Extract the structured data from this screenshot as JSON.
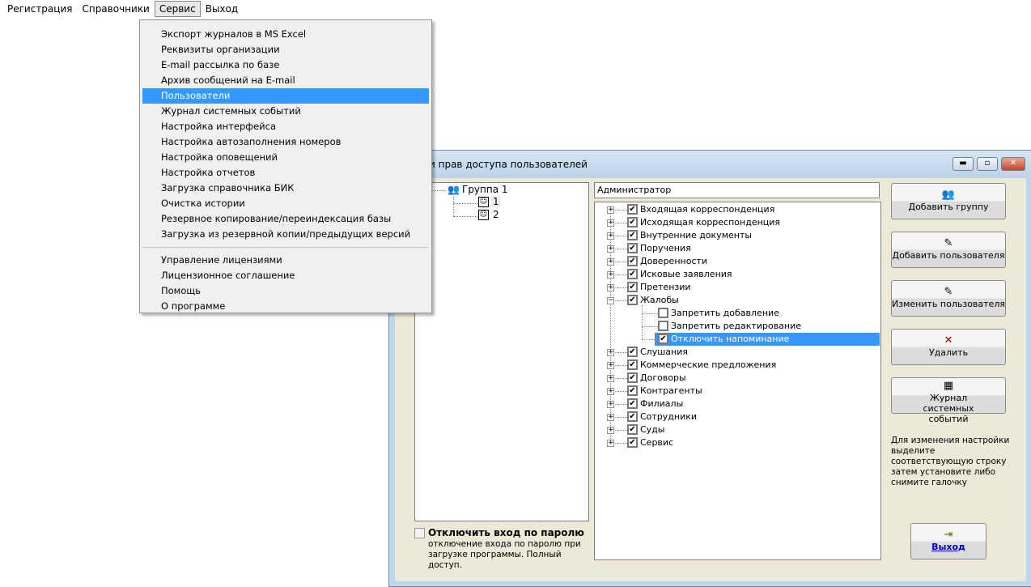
{
  "menubar": [
    "Регистрация",
    "Справочники",
    "Сервис",
    "Выход"
  ],
  "dropdown": {
    "group1": [
      "Экспорт журналов в MS Excel",
      "Реквизиты организации",
      "E-mail рассылка по базе",
      "Архив сообщений на E-mail",
      "Пользователи",
      "Журнал системных событий",
      "Настройка интерфейса",
      "Настройка автозаполнения номеров",
      "Настройка оповещений",
      "Настройка отчетов",
      "Загрузка справочника БИК",
      "Очистка истории",
      "Резервное копирование/переиндексация базы",
      "Загрузка из резервной копии/предыдущих версий"
    ],
    "group2": [
      "Управление лицензиями",
      "Лицензионное соглашение",
      "Помощь",
      "О программе"
    ],
    "selected": "Пользователи"
  },
  "window": {
    "title": "Настройки прав доступа пользователей",
    "title_visible": "тройки прав доступа пользователей"
  },
  "users_tree": {
    "group": "Группа 1",
    "users": [
      "1",
      "2"
    ]
  },
  "selected_user_field": "Администратор",
  "rights": [
    {
      "label": "Входящая корреспонденция",
      "checked": true
    },
    {
      "label": "Исходящая корреспонденция",
      "checked": true
    },
    {
      "label": "Внутренние документы",
      "checked": true
    },
    {
      "label": "Поручения",
      "checked": true
    },
    {
      "label": "Доверенности",
      "checked": true
    },
    {
      "label": "Исковые заявления",
      "checked": true
    },
    {
      "label": "Претензии",
      "checked": true
    },
    {
      "label": "Жалобы",
      "checked": true,
      "expanded": true,
      "children": [
        {
          "label": "Запретить добавление",
          "checked": false
        },
        {
          "label": "Запретить редактирование",
          "checked": false
        },
        {
          "label": "Отключить напоминание",
          "checked": true,
          "selected": true
        }
      ]
    },
    {
      "label": "Слушания",
      "checked": true
    },
    {
      "label": "Коммерческие предложения",
      "checked": true
    },
    {
      "label": "Договоры",
      "checked": true
    },
    {
      "label": "Контрагенты",
      "checked": true
    },
    {
      "label": "Филиалы",
      "checked": true
    },
    {
      "label": "Сотрудники",
      "checked": true
    },
    {
      "label": "Суды",
      "checked": true
    },
    {
      "label": "Сервис",
      "checked": true
    }
  ],
  "buttons": {
    "add_group": "Добавить группу",
    "add_user": "Добавить пользователя",
    "edit_user": "Изменить пользователя",
    "delete": "Удалить",
    "journal": "Журнал системных событий",
    "exit": "Выход"
  },
  "hint": "Для изменения настройки выделите соответствующую строку затем установите либо снимите галочку",
  "password_option": {
    "label": "Отключить вход по паролю",
    "description": "отключение входа по паролю при загрузке программы. Полный доступ.",
    "checked": false
  }
}
